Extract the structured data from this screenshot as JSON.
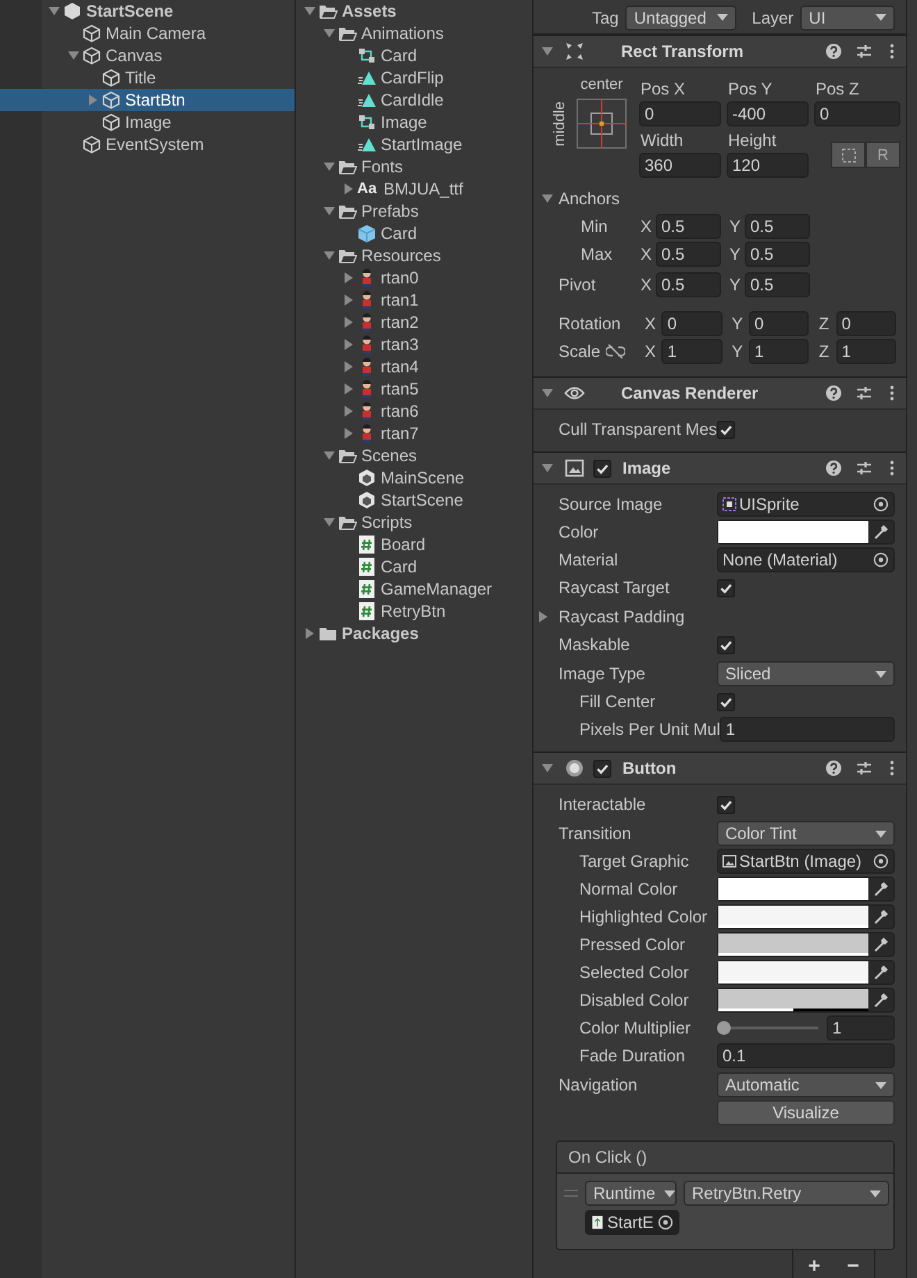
{
  "hierarchy": {
    "scene": {
      "name": "StartScene",
      "expanded": true,
      "children": [
        {
          "name": "Main Camera",
          "selected": false
        },
        {
          "name": "Canvas",
          "selected": false,
          "expanded": true,
          "children": [
            {
              "name": "Title",
              "selected": false
            },
            {
              "name": "StartBtn",
              "selected": true,
              "expanded": false
            },
            {
              "name": "Image",
              "selected": false
            }
          ]
        },
        {
          "name": "EventSystem",
          "selected": false
        }
      ]
    }
  },
  "project": {
    "items": [
      {
        "name": "Assets",
        "kind": "folder",
        "expanded": true,
        "children": [
          {
            "name": "Animations",
            "kind": "folder",
            "expanded": true,
            "children": [
              {
                "name": "Card",
                "kind": "animator"
              },
              {
                "name": "CardFlip",
                "kind": "clip"
              },
              {
                "name": "CardIdle",
                "kind": "clip"
              },
              {
                "name": "Image",
                "kind": "animator"
              },
              {
                "name": "StartImage",
                "kind": "clip"
              }
            ]
          },
          {
            "name": "Fonts",
            "kind": "folder",
            "expanded": true,
            "children": [
              {
                "name": "BMJUA_ttf",
                "kind": "font",
                "badge": "Aa",
                "expanded": false
              }
            ]
          },
          {
            "name": "Prefabs",
            "kind": "folder",
            "expanded": true,
            "children": [
              {
                "name": "Card",
                "kind": "prefab"
              }
            ]
          },
          {
            "name": "Resources",
            "kind": "folder",
            "expanded": true,
            "children": [
              {
                "name": "rtan0",
                "kind": "sprite",
                "expanded": false
              },
              {
                "name": "rtan1",
                "kind": "sprite",
                "expanded": false
              },
              {
                "name": "rtan2",
                "kind": "sprite",
                "expanded": false
              },
              {
                "name": "rtan3",
                "kind": "sprite",
                "expanded": false
              },
              {
                "name": "rtan4",
                "kind": "sprite",
                "expanded": false
              },
              {
                "name": "rtan5",
                "kind": "sprite",
                "expanded": false
              },
              {
                "name": "rtan6",
                "kind": "sprite",
                "expanded": false
              },
              {
                "name": "rtan7",
                "kind": "sprite",
                "expanded": false
              }
            ]
          },
          {
            "name": "Scenes",
            "kind": "folder",
            "expanded": true,
            "children": [
              {
                "name": "MainScene",
                "kind": "scene"
              },
              {
                "name": "StartScene",
                "kind": "scene"
              }
            ]
          },
          {
            "name": "Scripts",
            "kind": "folder",
            "expanded": true,
            "children": [
              {
                "name": "Board",
                "kind": "script"
              },
              {
                "name": "Card",
                "kind": "script"
              },
              {
                "name": "GameManager",
                "kind": "script"
              },
              {
                "name": "RetryBtn",
                "kind": "script"
              }
            ]
          }
        ]
      },
      {
        "name": "Packages",
        "kind": "folder",
        "expanded": false
      }
    ]
  },
  "inspector": {
    "tag_label": "Tag",
    "tag": "Untagged",
    "layer_label": "Layer",
    "layer": "UI",
    "components": [
      {
        "kind": "rect_transform",
        "title": "Rect Transform",
        "expanded": true,
        "anchor_preset": {
          "horizontal": "center",
          "vertical": "middle"
        },
        "fields": [
          {
            "label": "Pos X",
            "value": "0"
          },
          {
            "label": "Pos Y",
            "value": "-400"
          },
          {
            "label": "Pos Z",
            "value": "0"
          },
          {
            "label": "Width",
            "value": "360"
          },
          {
            "label": "Height",
            "value": "120"
          }
        ],
        "raw_button": "R",
        "anchors": {
          "label": "Anchors",
          "expanded": true,
          "rows": [
            {
              "label": "Min",
              "axes": [
                {
                  "axis": "X",
                  "value": "0.5"
                },
                {
                  "axis": "Y",
                  "value": "0.5"
                }
              ]
            },
            {
              "label": "Max",
              "axes": [
                {
                  "axis": "X",
                  "value": "0.5"
                },
                {
                  "axis": "Y",
                  "value": "0.5"
                }
              ]
            }
          ]
        },
        "pivot": {
          "label": "Pivot",
          "axes": [
            {
              "axis": "X",
              "value": "0.5"
            },
            {
              "axis": "Y",
              "value": "0.5"
            }
          ]
        },
        "rotation": {
          "label": "Rotation",
          "axes": [
            {
              "axis": "X",
              "value": "0"
            },
            {
              "axis": "Y",
              "value": "0"
            },
            {
              "axis": "Z",
              "value": "0"
            }
          ]
        },
        "scale": {
          "label": "Scale",
          "axes": [
            {
              "axis": "X",
              "value": "1"
            },
            {
              "axis": "Y",
              "value": "1"
            },
            {
              "axis": "Z",
              "value": "1"
            }
          ]
        }
      },
      {
        "kind": "canvas_renderer",
        "title": "Canvas Renderer",
        "expanded": true,
        "properties": [
          {
            "label": "Cull Transparent Mes",
            "kind": "check",
            "checked": true
          }
        ]
      },
      {
        "kind": "image",
        "title": "Image",
        "enabled": true,
        "expanded": true,
        "properties": [
          {
            "label": "Source Image",
            "kind": "sprite",
            "value": "UISprite"
          },
          {
            "label": "Color",
            "kind": "color",
            "color": "#ffffff",
            "level": 1
          },
          {
            "label": "Material",
            "kind": "object",
            "value": "None (Material)"
          },
          {
            "label": "Raycast Target",
            "kind": "check",
            "checked": true
          },
          {
            "label": "Raycast Padding",
            "kind": "foldout",
            "expanded": false
          },
          {
            "label": "Maskable",
            "kind": "check",
            "checked": true
          },
          {
            "label": "Image Type",
            "kind": "dropdown",
            "value": "Sliced",
            "children": [
              {
                "label": "Fill Center",
                "kind": "check",
                "checked": true
              },
              {
                "label": "Pixels Per Unit Mul",
                "kind": "number",
                "value": "1"
              }
            ]
          }
        ]
      },
      {
        "kind": "button",
        "title": "Button",
        "enabled": true,
        "expanded": true,
        "properties": [
          {
            "label": "Interactable",
            "kind": "check",
            "checked": true
          },
          {
            "label": "Transition",
            "kind": "dropdown",
            "value": "Color Tint",
            "children": [
              {
                "label": "Target Graphic",
                "kind": "image",
                "value": "StartBtn (Image)"
              },
              {
                "label": "Normal Color",
                "kind": "color",
                "color": "#ffffff",
                "level": 1
              },
              {
                "label": "Highlighted Color",
                "kind": "color",
                "color": "#f5f5f5",
                "level": 1
              },
              {
                "label": "Pressed Color",
                "kind": "color",
                "color": "#c8c8c8",
                "level": 1
              },
              {
                "label": "Selected Color",
                "kind": "color",
                "color": "#f5f5f5",
                "level": 1
              },
              {
                "label": "Disabled Color",
                "kind": "color",
                "color": "#c8c8c8",
                "level": 0.5
              },
              {
                "label": "Color Multiplier",
                "kind": "slider",
                "level": 0,
                "value": "1"
              },
              {
                "label": "Fade Duration",
                "kind": "number",
                "value": "0.1"
              }
            ]
          },
          {
            "label": "Navigation",
            "kind": "dropdown",
            "value": "Automatic"
          },
          {
            "label": "Visualize",
            "kind": "button"
          }
        ],
        "event": {
          "title": "On Click ()",
          "entries": [
            {
              "call_state": "Runtime",
              "function": "RetryBtn.Retry",
              "target": "StartE"
            }
          ],
          "add": "+",
          "remove": "−"
        }
      }
    ]
  }
}
